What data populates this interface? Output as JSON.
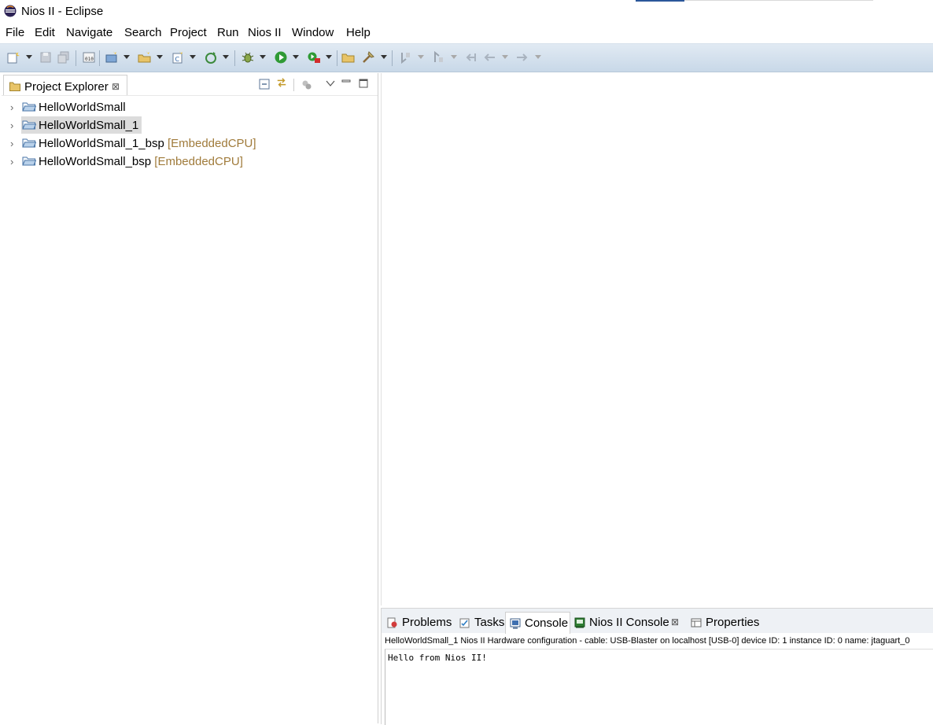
{
  "window": {
    "title": "Nios II - Eclipse",
    "icon": "eclipse-icon"
  },
  "menubar": {
    "items": [
      "File",
      "Edit",
      "Navigate",
      "Search",
      "Project",
      "Run",
      "Nios II",
      "Window",
      "Help"
    ]
  },
  "toolbar": {
    "icons": [
      "new-wizard-icon",
      "save-icon",
      "save-all-icon",
      "binary-icon",
      "new-project-icon",
      "new-folder-icon",
      "new-class-icon",
      "refresh-icon",
      "debug-icon",
      "run-icon",
      "external-tools-icon",
      "open-icon",
      "build-icon",
      "next-annotation-icon",
      "previous-annotation-icon",
      "last-edit-icon",
      "back-icon",
      "forward-icon"
    ]
  },
  "project_explorer": {
    "tab_label": "Project Explorer",
    "close_glyph": "⊠",
    "tree": [
      {
        "label": "HelloWorldSmall",
        "decoration": "",
        "selected": false
      },
      {
        "label": "HelloWorldSmall_1",
        "decoration": "",
        "selected": true
      },
      {
        "label": "HelloWorldSmall_1_bsp",
        "decoration": "[EmbeddedCPU]",
        "selected": false
      },
      {
        "label": "HelloWorldSmall_bsp",
        "decoration": "[EmbeddedCPU]",
        "selected": false
      }
    ]
  },
  "bottom_panel": {
    "tabs": [
      {
        "label": "Problems",
        "icon": "problems-icon",
        "active": false
      },
      {
        "label": "Tasks",
        "icon": "tasks-icon",
        "active": false
      },
      {
        "label": "Console",
        "icon": "console-icon",
        "active": true
      },
      {
        "label": "Nios II Console",
        "icon": "nios-console-icon",
        "active": false,
        "closable": true
      },
      {
        "label": "Properties",
        "icon": "properties-icon",
        "active": false
      }
    ],
    "console_description": "HelloWorldSmall_1 Nios II Hardware configuration - cable: USB-Blaster on localhost [USB-0] device ID: 1 instance ID: 0 name: jtaguart_0",
    "console_output": "Hello from Nios II!"
  },
  "colors": {
    "toolbar_top": "#e1eaf3",
    "toolbar_bottom": "#c8d8e8",
    "selection": "#dcdcdc",
    "decoration_text": "#a07b3b"
  }
}
